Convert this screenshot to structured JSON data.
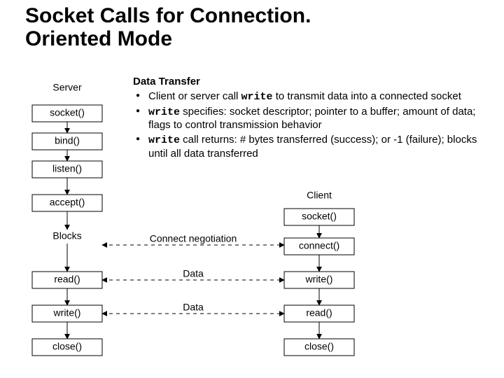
{
  "title_l1": "Socket Calls for Connection.",
  "title_l2": "Oriented Mode",
  "dt_heading": "Data Transfer",
  "bullets": {
    "b1_pre": "Client or server call ",
    "b1_code": "write",
    "b1_post": " to transmit data into a connected socket",
    "b2_code": "write",
    "b2_post": " specifies: socket descriptor; pointer to a buffer; amount of data; flags to control transmission behavior",
    "b3_code": "write",
    "b3_post": " call returns: # bytes transferred (success); or -1 (failure); blocks until all data transferred"
  },
  "labels": {
    "server": "Server",
    "client": "Client",
    "blocks": "Blocks",
    "connect_neg": "Connect negotiation",
    "data": "Data"
  },
  "server_boxes": [
    "socket()",
    "bind()",
    "listen()",
    "accept()",
    "read()",
    "write()",
    "close()"
  ],
  "client_boxes": [
    "socket()",
    "connect()",
    "write()",
    "read()",
    "close()"
  ]
}
